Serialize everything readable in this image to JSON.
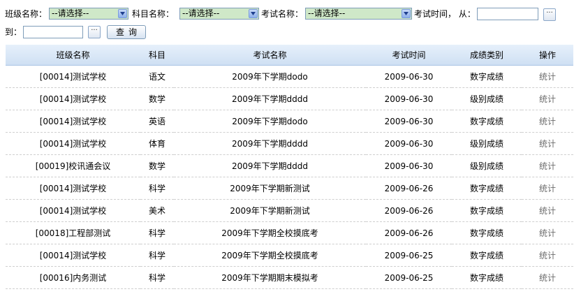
{
  "filters": {
    "class_label": "班级名称：",
    "class_value": "--请选择--",
    "subject_label": "科目名称：",
    "subject_value": "--请选择--",
    "exam_label": "考试名称：",
    "exam_value": "--请选择--",
    "time_label": "考试时间， 从：",
    "from_value": "",
    "to_label": "到：",
    "to_value": "",
    "picker_label": "···",
    "query_label": "查询"
  },
  "table": {
    "headers": [
      "班级名称",
      "科目",
      "考试名称",
      "考试时间",
      "成绩类别",
      "操作"
    ],
    "rows": [
      {
        "class": "[00014]测试学校",
        "subject": "语文",
        "exam": "2009年下学期dodo",
        "date": "2009-06-30",
        "type": "数字成绩",
        "action": "统计"
      },
      {
        "class": "[00014]测试学校",
        "subject": "数学",
        "exam": "2009年下学期dddd",
        "date": "2009-06-30",
        "type": "级别成绩",
        "action": "统计"
      },
      {
        "class": "[00014]测试学校",
        "subject": "英语",
        "exam": "2009年下学期dodo",
        "date": "2009-06-30",
        "type": "数字成绩",
        "action": "统计"
      },
      {
        "class": "[00014]测试学校",
        "subject": "体育",
        "exam": "2009年下学期dddd",
        "date": "2009-06-30",
        "type": "级别成绩",
        "action": "统计"
      },
      {
        "class": "[00019]校讯通会议",
        "subject": "数学",
        "exam": "2009年下学期dddd",
        "date": "2009-06-30",
        "type": "级别成绩",
        "action": "统计"
      },
      {
        "class": "[00014]测试学校",
        "subject": "科学",
        "exam": "2009年下学期新测试",
        "date": "2009-06-26",
        "type": "数字成绩",
        "action": "统计"
      },
      {
        "class": "[00014]测试学校",
        "subject": "美术",
        "exam": "2009年下学期新测试",
        "date": "2009-06-26",
        "type": "数字成绩",
        "action": "统计"
      },
      {
        "class": "[00018]工程部测试",
        "subject": "科学",
        "exam": "2009年下学期全校摸底考",
        "date": "2009-06-26",
        "type": "数字成绩",
        "action": "统计"
      },
      {
        "class": "[00014]测试学校",
        "subject": "科学",
        "exam": "2009年下学期全校摸底考",
        "date": "2009-06-25",
        "type": "数字成绩",
        "action": "统计"
      },
      {
        "class": "[00016]内务测试",
        "subject": "科学",
        "exam": "2009年下学期期末模拟考",
        "date": "2009-06-25",
        "type": "数字成绩",
        "action": "统计"
      }
    ]
  }
}
